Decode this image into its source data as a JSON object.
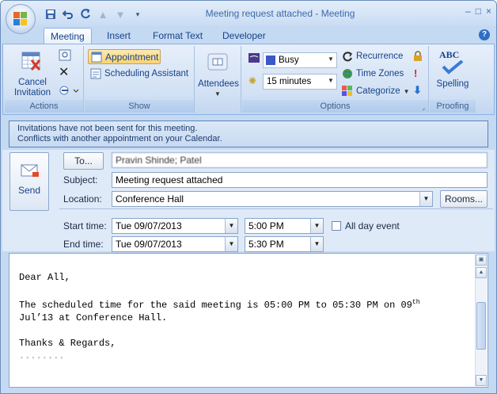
{
  "window": {
    "title": "Meeting request attached - Meeting",
    "controls": {
      "minimize": "–",
      "maximize": "□",
      "close": "×"
    }
  },
  "quick_access": {
    "save_icon": "save-icon",
    "undo_icon": "undo-icon",
    "redo_icon": "redo-icon"
  },
  "tabs": [
    {
      "label": "Meeting",
      "active": true
    },
    {
      "label": "Insert",
      "active": false
    },
    {
      "label": "Format Text",
      "active": false
    },
    {
      "label": "Developer",
      "active": false
    }
  ],
  "help": "?",
  "ribbon": {
    "actions": {
      "label": "Actions",
      "cancel_invitation": "Cancel\nInvitation"
    },
    "show": {
      "label": "Show",
      "appointment": "Appointment",
      "scheduling_assistant": "Scheduling Assistant"
    },
    "attendees": {
      "label": "Attendees"
    },
    "options": {
      "label": "Options",
      "show_as_value": "Busy",
      "reminder_value": "15 minutes",
      "recurrence": "Recurrence",
      "time_zones": "Time Zones",
      "categorize": "Categorize"
    },
    "proofing": {
      "label": "Proofing",
      "spelling": "Spelling",
      "abc": "ABC"
    }
  },
  "infobar": {
    "line1": "Invitations have not been sent for this meeting.",
    "line2": "Conflicts with another appointment on your Calendar."
  },
  "form": {
    "send": "Send",
    "to_button": "To...",
    "to_value": "Pravin Shinde; Patel",
    "subject_label": "Subject:",
    "subject_value": "Meeting request attached",
    "location_label": "Location:",
    "location_value": "Conference Hall",
    "rooms_button": "Rooms...",
    "start_label": "Start time:",
    "start_date": "Tue 09/07/2013",
    "start_time": "5:00 PM",
    "end_label": "End time:",
    "end_date": "Tue 09/07/2013",
    "end_time": "5:30 PM",
    "all_day_label": "All day event",
    "all_day_checked": false
  },
  "body": {
    "greeting": "Dear All,",
    "line1_a": "The scheduled time for the said meeting is 05:00 PM to 05:30 PM on 09",
    "line1_sup": "th",
    "line2": "Jul’13 at Conference Hall.",
    "closing": "Thanks & Regards,",
    "signature": "........"
  },
  "colors": {
    "accent": "#15428b",
    "ribbon_bg": "#d2e1f4",
    "highlight": "#fbd36e"
  }
}
